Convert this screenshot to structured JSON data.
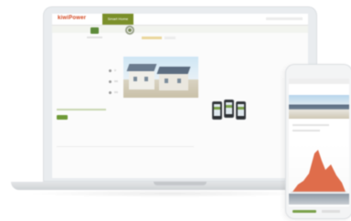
{
  "laptop": {
    "brand_logo": "kiwiPower",
    "nav_tab_label": "Smart Home"
  },
  "phone": {
    "chart_color": "#d9542b"
  },
  "colors": {
    "brand_orange": "#d2451e",
    "accent_green": "#6e9a36",
    "device_frame": "#e9ecef"
  },
  "icons": [
    "leaf-tile-icon",
    "circle-badge-icon"
  ]
}
